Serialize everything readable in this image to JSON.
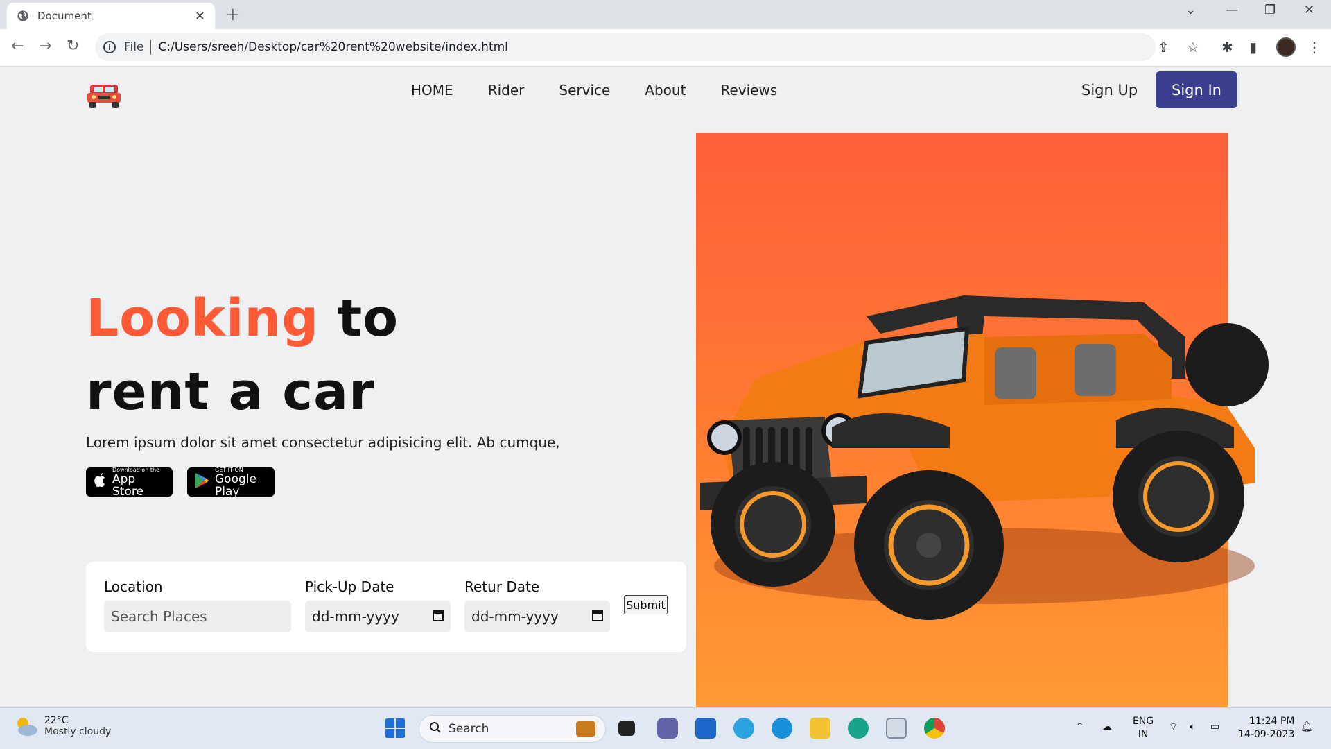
{
  "browser": {
    "tab_title": "Document",
    "file_label": "File",
    "url": "C:/Users/sreeh/Desktop/car%20rent%20website/index.html"
  },
  "site": {
    "nav": [
      "HOME",
      "Rider",
      "Service",
      "About",
      "Reviews"
    ],
    "signup": "Sign Up",
    "signin": "Sign In",
    "headline_accent": "Looking",
    "headline_rest1": " to",
    "headline_rest2": "rent a car",
    "lede": "Lorem ipsum dolor sit amet consectetur adipisicing elit. Ab cumque,",
    "appstore_small": "Download on the",
    "appstore_big": "App Store",
    "gplay_small": "GET IT ON",
    "gplay_big": "Google Play",
    "form": {
      "location_label": "Location",
      "location_placeholder": "Search Places",
      "pickup_label": "Pick-Up Date",
      "pickup_value": "dd-mm-yyyy",
      "return_label": "Retur Date",
      "return_value": "dd-mm-yyyy",
      "submit": "Submit"
    },
    "colors": {
      "accent": "#ff5a36",
      "primary_button": "#3a3f8f",
      "hero_top": "#ff5f3b",
      "hero_bottom": "#ff9a35"
    }
  },
  "taskbar": {
    "weather_temp": "22°C",
    "weather_cond": "Mostly cloudy",
    "search_label": "Search",
    "lang1": "ENG",
    "lang2": "IN",
    "time": "11:24 PM",
    "date": "14-09-2023"
  }
}
